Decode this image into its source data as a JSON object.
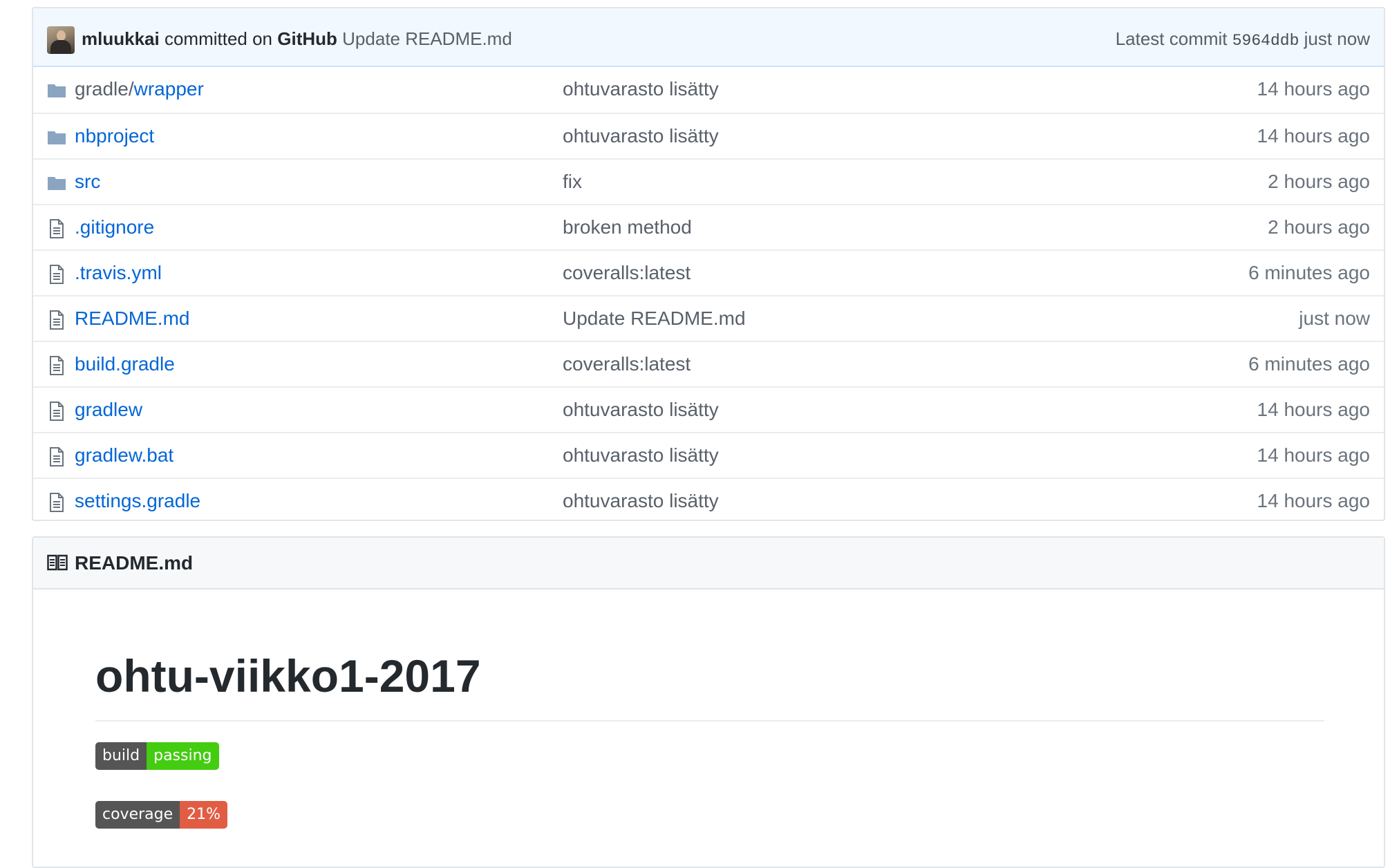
{
  "commit": {
    "author": "mluukkai",
    "committed_on": "committed on",
    "platform": "GitHub",
    "message": "Update README.md",
    "latest_label": "Latest commit",
    "sha": "5964ddb",
    "time": "just now"
  },
  "files": [
    {
      "type": "folder",
      "name_prefix": "gradle/",
      "name": "wrapper",
      "message": "ohtuvarasto lisätty",
      "age": "14 hours ago"
    },
    {
      "type": "folder",
      "name_prefix": "",
      "name": "nbproject",
      "message": "ohtuvarasto lisätty",
      "age": "14 hours ago"
    },
    {
      "type": "folder",
      "name_prefix": "",
      "name": "src",
      "message": "fix",
      "age": "2 hours ago"
    },
    {
      "type": "file",
      "name_prefix": "",
      "name": ".gitignore",
      "message": "broken method",
      "age": "2 hours ago"
    },
    {
      "type": "file",
      "name_prefix": "",
      "name": ".travis.yml",
      "message": "coveralls:latest",
      "age": "6 minutes ago"
    },
    {
      "type": "file",
      "name_prefix": "",
      "name": "README.md",
      "message": "Update README.md",
      "age": "just now"
    },
    {
      "type": "file",
      "name_prefix": "",
      "name": "build.gradle",
      "message": "coveralls:latest",
      "age": "6 minutes ago"
    },
    {
      "type": "file",
      "name_prefix": "",
      "name": "gradlew",
      "message": "ohtuvarasto lisätty",
      "age": "14 hours ago"
    },
    {
      "type": "file",
      "name_prefix": "",
      "name": "gradlew.bat",
      "message": "ohtuvarasto lisätty",
      "age": "14 hours ago"
    },
    {
      "type": "file",
      "name_prefix": "",
      "name": "settings.gradle",
      "message": "ohtuvarasto lisätty",
      "age": "14 hours ago"
    }
  ],
  "readme": {
    "header": "README.md",
    "heading": "ohtu-viikko1-2017",
    "badges": [
      {
        "label": "build",
        "value": "passing",
        "color": "#44cc11"
      },
      {
        "label": "coverage",
        "value": "21%",
        "color": "#e05d44"
      }
    ]
  },
  "colors": {
    "link": "#0366d6",
    "muted": "#586069",
    "commit_bar_bg": "#f1f8ff",
    "folder_icon": "#79b8ff"
  },
  "icons": {
    "folder": "folder-icon",
    "file": "file-icon",
    "readme": "book-icon"
  }
}
